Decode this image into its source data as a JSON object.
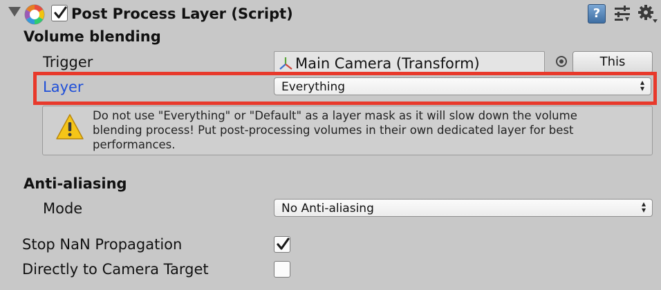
{
  "component": {
    "title": "Post Process Layer (Script)",
    "enabled": true,
    "help_glyph": "?"
  },
  "volume_blending": {
    "section_label": "Volume blending",
    "trigger": {
      "label": "Trigger",
      "value": "Main Camera (Transform)",
      "button_label": "This"
    },
    "layer": {
      "label": "Layer",
      "value": "Everything"
    },
    "warning_lines": [
      "Do not use \"Everything\" or \"Default\" as a layer mask as it will slow down the volume",
      "blending process! Put post-processing volumes in their own dedicated layer for best",
      "performances."
    ]
  },
  "anti_aliasing": {
    "section_label": "Anti-aliasing",
    "mode": {
      "label": "Mode",
      "value": "No Anti-aliasing"
    }
  },
  "stop_nan": {
    "label": "Stop NaN Propagation",
    "checked": true
  },
  "direct_to_target": {
    "label": "Directly to Camera Target",
    "checked": false
  },
  "colors": {
    "highlight": "#e8392b",
    "layer_label": "#1f4fd8",
    "background": "#c8c8c8"
  },
  "icons": [
    "foldout-arrow-icon",
    "script-icon",
    "help-icon",
    "preset-icon",
    "gear-icon",
    "transform-icon",
    "object-picker-icon",
    "warning-icon",
    "checkmark-icon"
  ]
}
